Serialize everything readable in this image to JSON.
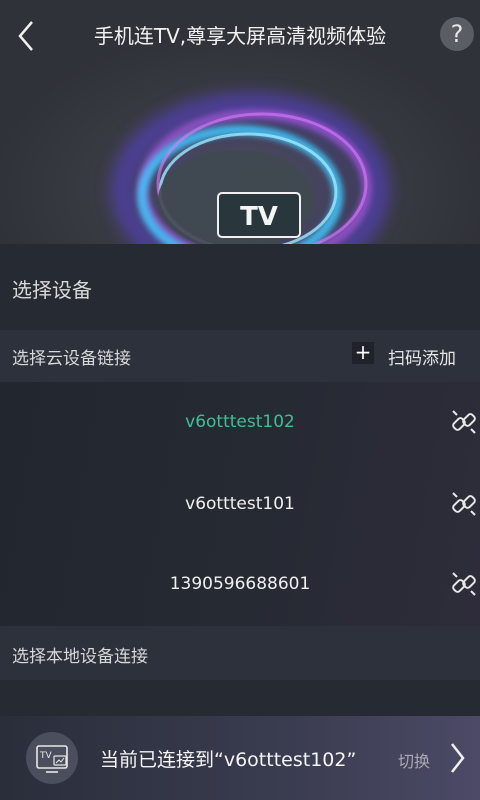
{
  "header": {
    "title": "手机连TV,尊享大屏高清视频体验",
    "help_label": "?",
    "tv_badge": "TV"
  },
  "select_device": {
    "title": "选择设备"
  },
  "cloud": {
    "label": "选择云设备链接",
    "add_plus": "+",
    "add_label": "扫码添加",
    "devices": [
      {
        "name": "v6otttest102",
        "active": true
      },
      {
        "name": "v6otttest101",
        "active": false
      },
      {
        "name": "1390596688601",
        "active": false
      }
    ]
  },
  "local": {
    "label": "选择本地设备连接"
  },
  "bottom_bar": {
    "tv_icon_label": "TV",
    "status": "当前已连接到“v6otttest102”",
    "switch_label": "切换"
  },
  "colors": {
    "active_device": "#3fbf98",
    "background": "#262a33",
    "section_header": "#2c313b"
  },
  "icons": {
    "back": "chevron-left-icon",
    "help": "question-icon",
    "add": "plus-icon",
    "unlink": "unlink-icon",
    "tv": "tv-icon",
    "next": "chevron-right-icon"
  }
}
